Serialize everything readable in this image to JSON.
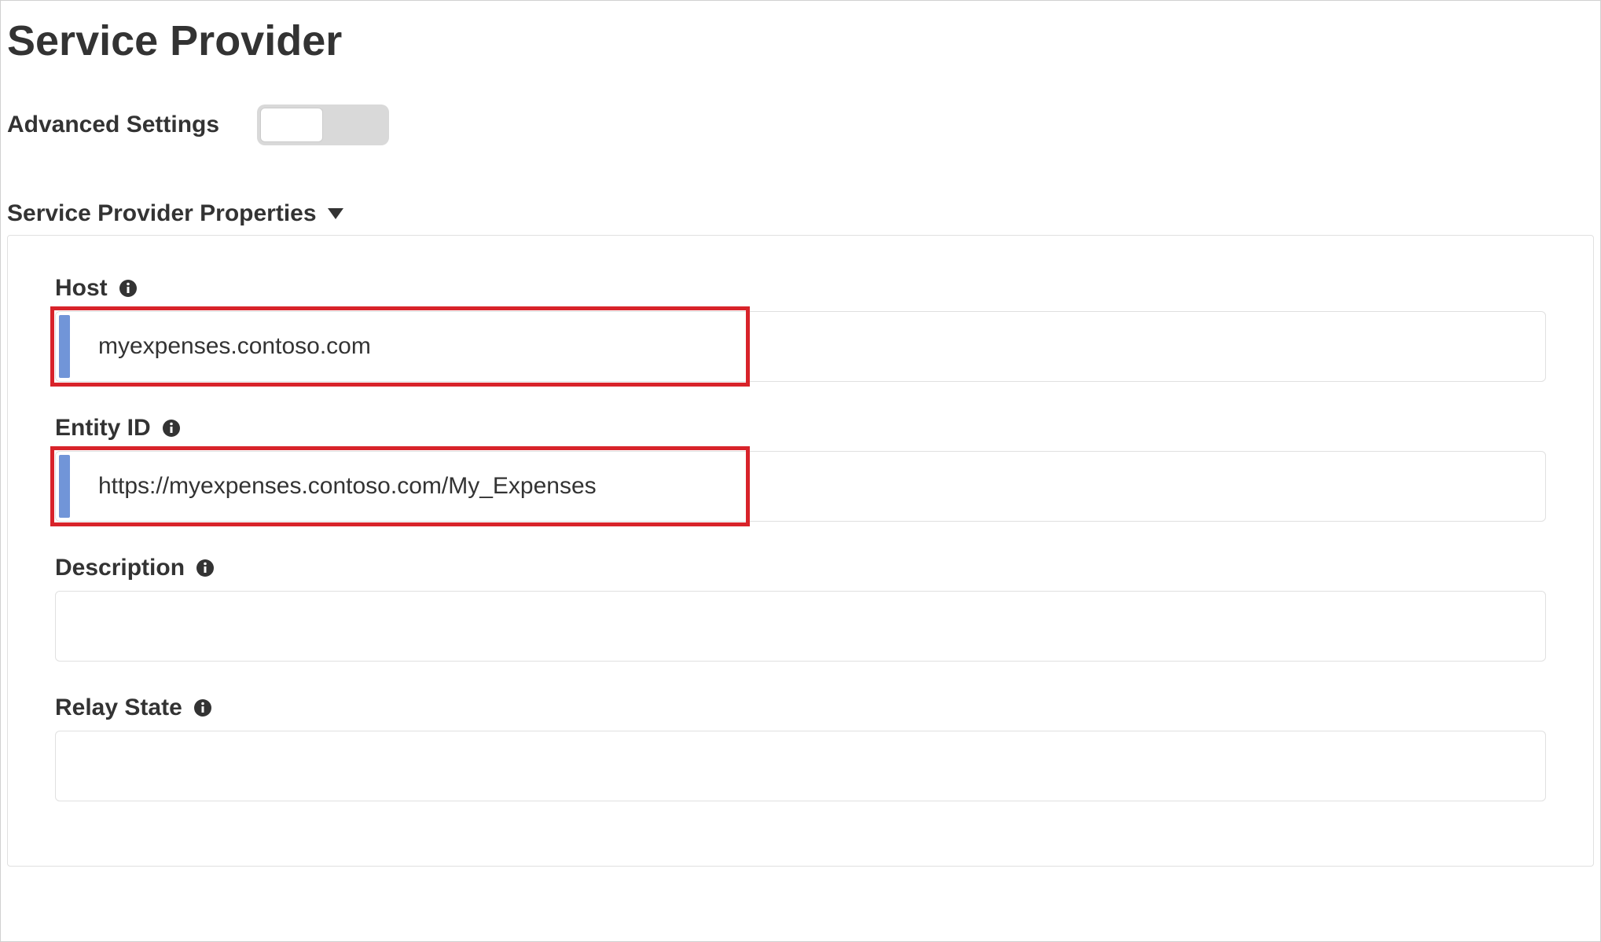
{
  "page": {
    "title": "Service Provider"
  },
  "advanced": {
    "label": "Advanced Settings",
    "enabled": false
  },
  "section": {
    "title": "Service Provider Properties"
  },
  "fields": {
    "host": {
      "label": "Host",
      "value": "myexpenses.contoso.com"
    },
    "entityId": {
      "label": "Entity ID",
      "value": "https://myexpenses.contoso.com/My_Expenses"
    },
    "description": {
      "label": "Description",
      "value": ""
    },
    "relayState": {
      "label": "Relay State",
      "value": ""
    }
  }
}
